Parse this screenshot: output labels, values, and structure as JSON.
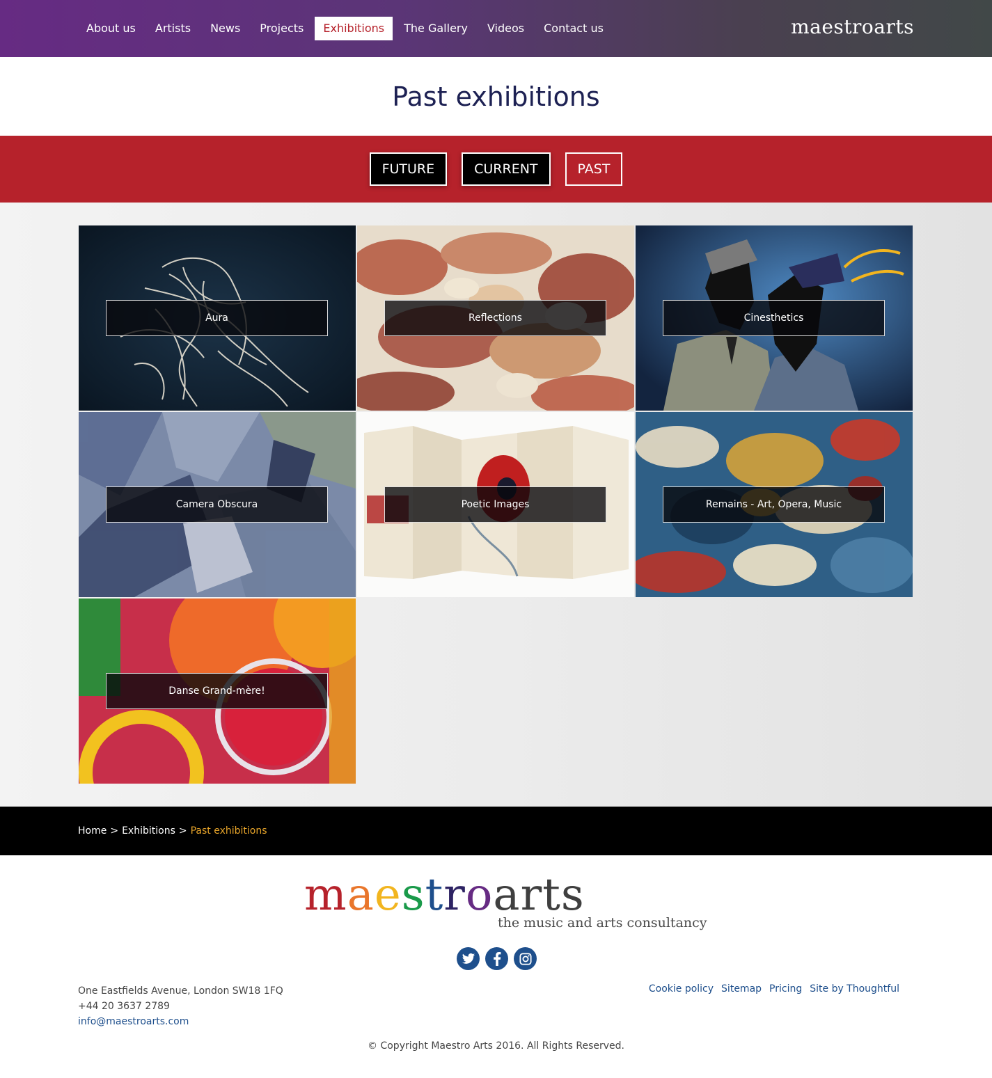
{
  "header": {
    "nav": [
      "About us",
      "Artists",
      "News",
      "Projects",
      "Exhibitions",
      "The Gallery",
      "Videos",
      "Contact us"
    ],
    "active_index": 4,
    "brand": "maestroarts"
  },
  "page_title": "Past exhibitions",
  "filters": [
    "FUTURE",
    "CURRENT",
    "PAST"
  ],
  "exhibitions": [
    {
      "title": "Aura"
    },
    {
      "title": "Reflections"
    },
    {
      "title": "Cinesthetics"
    },
    {
      "title": "Camera Obscura"
    },
    {
      "title": "Poetic Images"
    },
    {
      "title": "Remains - Art, Opera, Music"
    },
    {
      "title": "Danse Grand-mère!"
    }
  ],
  "breadcrumb": {
    "items": [
      "Home",
      "Exhibitions"
    ],
    "current": "Past exhibitions",
    "separator": ">"
  },
  "footer": {
    "logo_letters": [
      "m",
      "a",
      "e",
      "s",
      "t",
      "r",
      "o",
      "a",
      "r",
      "t",
      "s"
    ],
    "logo_colors": [
      "#b6222b",
      "#e9762b",
      "#f2b51f",
      "#1a9a4a",
      "#1e4f8c",
      "#2d2363",
      "#662b83",
      "#3f3f3f",
      "#3f3f3f",
      "#3f3f3f",
      "#3f3f3f"
    ],
    "tagline": "the music and arts consultancy",
    "socials": [
      "twitter-icon",
      "facebook-icon",
      "instagram-icon"
    ],
    "address": "One Eastfields Avenue, London SW18 1FQ",
    "phone": "+44 20 3637 2789",
    "email": "info@maestroarts.com",
    "links": [
      "Cookie policy",
      "Sitemap",
      "Pricing",
      "Site by Thoughtful"
    ],
    "copyright": "© Copyright Maestro Arts 2016. All Rights Reserved."
  },
  "colors": {
    "accent_red": "#b6222b",
    "navy": "#1d2153",
    "link_blue": "#1e4f8c",
    "breadcrumb_current": "#e8a52a"
  }
}
